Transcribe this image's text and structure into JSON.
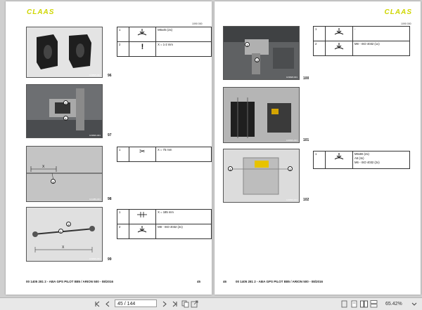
{
  "left_page": {
    "brand": "CLAAS",
    "doc_code": "1090 000",
    "figures": [
      {
        "num": "96",
        "caption": "103825-001"
      },
      {
        "num": "97",
        "caption": "103826-001"
      },
      {
        "num": "98",
        "caption": "141089-001"
      },
      {
        "num": "99",
        "caption": "103829-001"
      }
    ],
    "tables": [
      {
        "rows": [
          {
            "n": "1",
            "icon": "tighten-icon",
            "lines": [
              "M6x45 (2x)"
            ]
          },
          {
            "n": "2",
            "icon": "exclamation-icon",
            "lines": [
              "X = 1-2 mm"
            ]
          }
        ]
      },
      {
        "rows": [
          {
            "n": "1",
            "icon": "scissors-icon",
            "lines": [
              "X = 75 mm"
            ]
          }
        ]
      },
      {
        "rows": [
          {
            "n": "1",
            "icon": "measure-icon",
            "lines": [
              "X = 185 mm"
            ]
          },
          {
            "n": "2",
            "icon": "tighten-icon",
            "lines": [
              "M8 - ISO 4032 (2x)"
            ]
          }
        ]
      }
    ],
    "footer": "00 1405 281 2 - ABA GPS PILOT B85 / ARION 500 - 08/2016",
    "page_number": "45"
  },
  "right_page": {
    "brand": "CLAAS",
    "doc_code": "1090 000",
    "figures": [
      {
        "num": "100",
        "caption": "103828-001"
      },
      {
        "num": "101",
        "caption": "140829-001"
      },
      {
        "num": "102",
        "caption": "140830-001"
      }
    ],
    "tables": [
      {
        "rows": [
          {
            "n": "1",
            "icon": "tighten-icon",
            "lines": [
              "-"
            ]
          },
          {
            "n": "2",
            "icon": "tighten-icon",
            "lines": [
              "M8 - ISO 4032 (1x)"
            ]
          }
        ]
      },
      {
        "rows": [
          {
            "n": "1",
            "icon": "tighten-icon",
            "lines": [
              "M6x55 (2x)",
              "A6 (4x)",
              "M6 - ISO 4032 (2x)"
            ]
          }
        ]
      }
    ],
    "footer": "00 1405 281 2 - ABA GPS PILOT B85 / ARION 500 - 08/2016",
    "page_number": "46"
  },
  "toolbar": {
    "page_indicator": "45 / 144",
    "zoom": "65.42%"
  }
}
